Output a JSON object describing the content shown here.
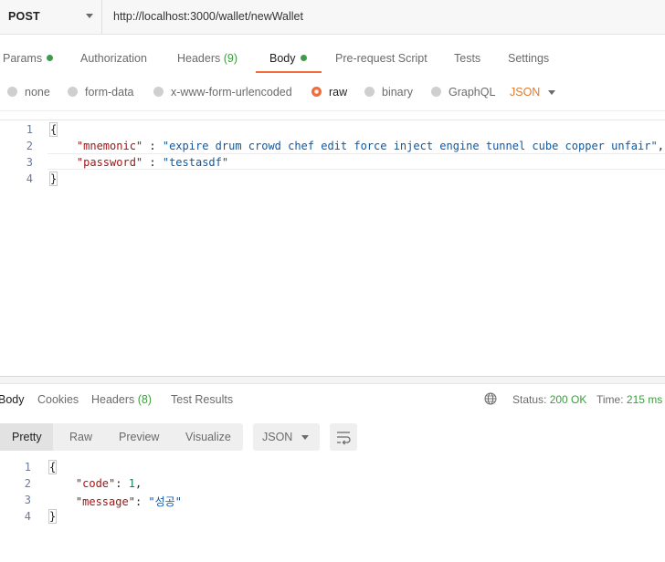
{
  "request": {
    "method": "POST",
    "url": "http://localhost:3000/wallet/newWallet"
  },
  "request_tabs": [
    {
      "label": "Params",
      "has_dot": true
    },
    {
      "label": "Authorization"
    },
    {
      "label": "Headers",
      "count": "(9)"
    },
    {
      "label": "Body",
      "has_dot": true,
      "active": true
    },
    {
      "label": "Pre-request Script"
    },
    {
      "label": "Tests"
    },
    {
      "label": "Settings"
    }
  ],
  "body_types": {
    "none": "none",
    "form_data": "form-data",
    "urlencoded": "x-www-form-urlencoded",
    "raw": "raw",
    "binary": "binary",
    "graphql": "GraphQL",
    "selected": "raw",
    "format": "JSON"
  },
  "request_body": {
    "line_numbers": [
      "1",
      "2",
      "3",
      "4"
    ],
    "open": "{",
    "mnemonic_key": "\"mnemonic\"",
    "mnemonic_value": "\"expire drum crowd chef edit force inject engine tunnel cube copper unfair\"",
    "password_key": "\"password\"",
    "password_value": "\"testasdf\"",
    "separator": " : ",
    "comma": ",",
    "close": "}"
  },
  "response_tabs": {
    "body": "Body",
    "cookies": "Cookies",
    "headers": "Headers",
    "headers_count": "(8)",
    "test_results": "Test Results"
  },
  "response_status": {
    "status_label": "Status:",
    "status_value": "200 OK",
    "time_label": "Time:",
    "time_value": "215 ms"
  },
  "response_view": {
    "pretty": "Pretty",
    "raw": "Raw",
    "preview": "Preview",
    "visualize": "Visualize",
    "format": "JSON"
  },
  "response_body": {
    "line_numbers": [
      "1",
      "2",
      "3",
      "4"
    ],
    "open": "{",
    "code_key": "\"code\"",
    "code_value": "1",
    "message_key": "\"message\"",
    "message_value": "\"성공\"",
    "close": "}"
  },
  "colors": {
    "accent": "#f26b3a",
    "success": "#3d9c3d",
    "json_key": "#a31515",
    "json_string": "#0b5aa8"
  }
}
